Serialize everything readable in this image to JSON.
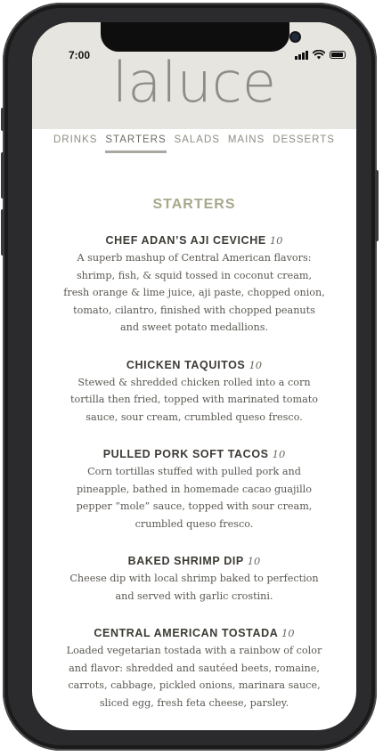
{
  "status_bar": {
    "time": "7:00"
  },
  "brand": {
    "logo_text": "laluce"
  },
  "nav": {
    "items": [
      {
        "label": "DRINKS"
      },
      {
        "label": "STARTERS"
      },
      {
        "label": "SALADS"
      },
      {
        "label": "MAINS"
      },
      {
        "label": "DESSERTS"
      }
    ],
    "active": "STARTERS"
  },
  "section": {
    "title": "STARTERS",
    "items": [
      {
        "name": "CHEF ADAN’S AJI CEVICHE",
        "price": "10",
        "desc_lines": [
          "A superb mashup of Central American flavors:",
          "shrimp, fish, & squid tossed in coconut cream,",
          "fresh orange & lime juice, aji paste, chopped onion,",
          "tomato, cilantro, finished with chopped peanuts",
          "and sweet potato medallions."
        ]
      },
      {
        "name": "CHICKEN TAQUITOS",
        "price": "10",
        "desc_lines": [
          "Stewed & shredded chicken rolled into a corn",
          "tortilla then fried, topped with marinated tomato",
          "sauce, sour cream, crumbled queso fresco."
        ]
      },
      {
        "name": "PULLED PORK SOFT TACOS",
        "price": "10",
        "desc_lines": [
          "Corn tortillas stuffed with pulled pork and",
          "pineapple, bathed in homemade cacao guajillo",
          "pepper “mole” sauce, topped with sour cream,",
          "crumbled queso fresco."
        ]
      },
      {
        "name": "BAKED SHRIMP DIP",
        "price": "10",
        "desc_lines": [
          "Cheese dip with local shrimp baked to perfection",
          "and served with garlic crostini."
        ]
      },
      {
        "name": "CENTRAL AMERICAN TOSTADA",
        "price": "10",
        "desc_lines": [
          "Loaded vegetarian tostada with a rainbow of color",
          "and flavor: shredded and sautéed beets, romaine,",
          "carrots, cabbage, pickled onions, marinara sauce,",
          "sliced egg, fresh feta cheese, parsley."
        ]
      }
    ]
  },
  "colors": {
    "header_bg": "#e6e5df",
    "section_title": "#a8a88c",
    "nav_text": "#8e8c84",
    "item_name": "#3d3a35",
    "body_text": "#5b5852"
  },
  "icons": {
    "signal": "cellular-signal-icon",
    "wifi": "wifi-icon",
    "battery": "battery-icon"
  }
}
